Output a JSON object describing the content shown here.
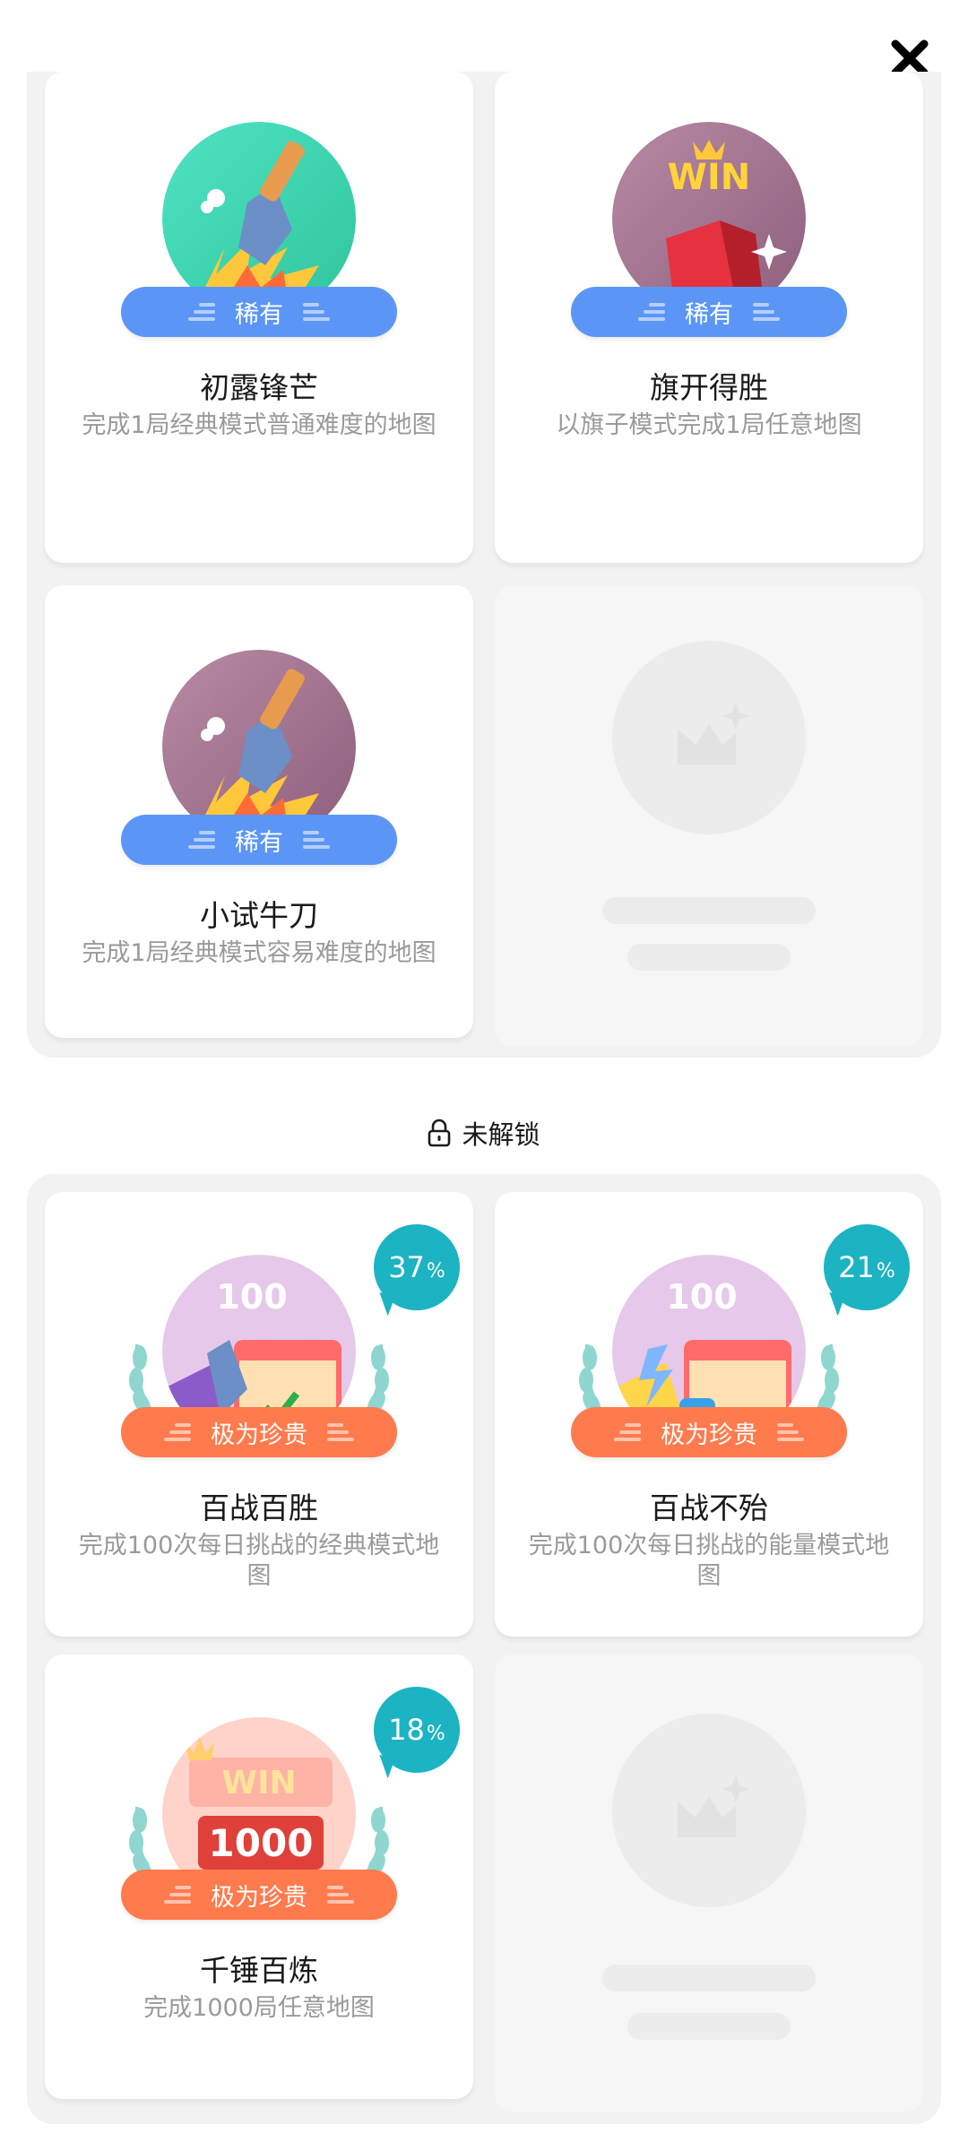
{
  "header": {
    "close_icon": "close-icon"
  },
  "unlocked": {
    "cards": [
      {
        "title": "初露锋芒",
        "desc": "完成1局经典模式普通难度的地图",
        "rarity": "稀有",
        "badge_icon": "shovel-explosion-icon"
      },
      {
        "title": "旗开得胜",
        "desc": "以旗子模式完成1局任意地图",
        "rarity": "稀有",
        "badge_icon": "win-flag-icon"
      },
      {
        "title": "小试牛刀",
        "desc": "完成1局经典模式容易难度的地图",
        "rarity": "稀有",
        "badge_icon": "shovel-explosion-icon"
      }
    ]
  },
  "locked_section": {
    "label": "未解锁",
    "icon": "lock-icon",
    "cards": [
      {
        "title": "百战百胜",
        "desc": "完成100次每日挑战的经典模式地图",
        "rarity": "极为珍贵",
        "progress": "37",
        "progress_unit": "%",
        "badge_icon": "calendar-100-icon"
      },
      {
        "title": "百战不殆",
        "desc": "完成100次每日挑战的能量模式地图",
        "rarity": "极为珍贵",
        "progress": "21",
        "progress_unit": "%",
        "badge_icon": "calendar-100-energy-icon"
      },
      {
        "title": "千锤百炼",
        "desc": "完成1000局任意地图",
        "rarity": "极为珍贵",
        "progress": "18",
        "progress_unit": "%",
        "badge_icon": "win-1000-icon"
      }
    ]
  },
  "colors": {
    "rare": "#5b96f6",
    "epic": "#ff7a4d",
    "progress": "#1cb3c3",
    "panel": "#f2f2f2"
  }
}
